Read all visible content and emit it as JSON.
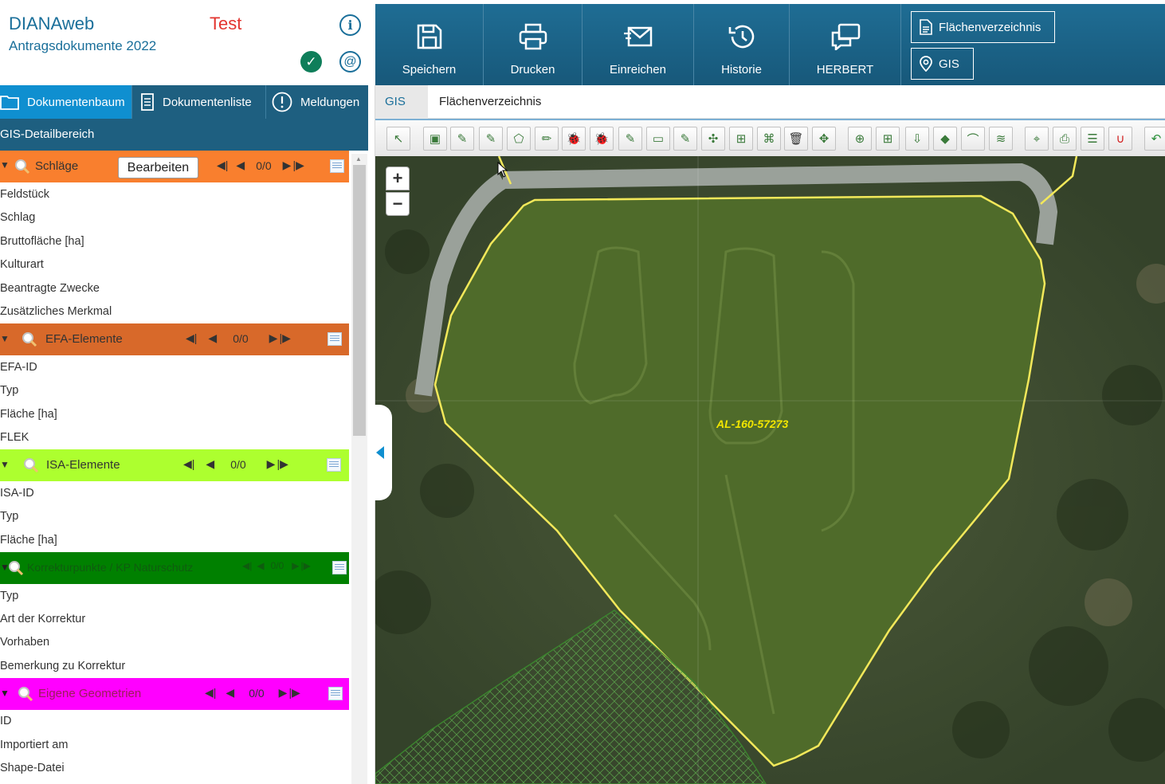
{
  "app": {
    "name": "DIANAweb",
    "subtitle": "Antragsdokumente 2022",
    "env_label": "Test"
  },
  "left_tabs": [
    {
      "label": "Dokumentenbaum",
      "active": true
    },
    {
      "label": "Dokumentenliste",
      "active": false
    },
    {
      "label": "Meldungen",
      "active": false
    }
  ],
  "detail_title": "GIS-Detailbereich",
  "groups": [
    {
      "title": "Schläge",
      "counter": "0/0",
      "color": "#f97f2e",
      "edit_label": "Bearbeiten",
      "fields": [
        "Feldstück",
        "Schlag",
        "Bruttofläche [ha]",
        "Kulturart",
        "Beantragte Zwecke",
        "Zusätzliches Merkmal"
      ]
    },
    {
      "title": "EFA-Elemente",
      "counter": "0/0",
      "color": "#d8692a",
      "fields": [
        "EFA-ID",
        "Typ",
        "Fläche [ha]",
        "FLEK"
      ]
    },
    {
      "title": "ISA-Elemente",
      "counter": "0/0",
      "color": "#adff2f",
      "fields": [
        "ISA-ID",
        "Typ",
        "Fläche [ha]"
      ]
    },
    {
      "title": "Korrekturpunkte / KP Naturschutz",
      "counter": "0/0",
      "color": "#008000",
      "fields": [
        "Typ",
        "Art der Korrektur",
        "Vorhaben",
        "Bemerkung zu Korrektur"
      ]
    },
    {
      "title": "Eigene Geometrien",
      "counter": "0/0",
      "color": "#ff00ff",
      "fields": [
        "ID",
        "Importiert am",
        "Shape-Datei"
      ]
    }
  ],
  "toolbar": {
    "buttons": [
      {
        "label": "Speichern",
        "icon": "save-icon"
      },
      {
        "label": "Drucken",
        "icon": "print-icon"
      },
      {
        "label": "Einreichen",
        "icon": "send-icon"
      },
      {
        "label": "Historie",
        "icon": "history-icon"
      },
      {
        "label": "HERBERT",
        "icon": "chat-icon"
      }
    ],
    "side_buttons": [
      {
        "label": "Flächenverzeichnis",
        "icon": "document-icon"
      },
      {
        "label": "GIS",
        "icon": "location-pin-icon"
      }
    ]
  },
  "sub_tabs": [
    {
      "label": "GIS",
      "active": true
    },
    {
      "label": "Flächenverzeichnis",
      "active": false
    }
  ],
  "map": {
    "zoom_in": "+",
    "zoom_out": "−",
    "parcel_label": "AL-160-57273",
    "outline_color": "#f2e85a"
  },
  "map_tools": [
    "select-arrow-icon",
    "add-polygon-icon",
    "edit-pencil-icon",
    "edit-pencil-blue-icon",
    "polygon-icon",
    "pencil-icon",
    "bug-icon",
    "bug-orange-icon",
    "pencil-yellow-icon",
    "note-icon",
    "pencil-green-icon",
    "split-icon",
    "merge-icon",
    "node-icon",
    "trash-icon",
    "move-icon",
    "search-layer-icon",
    "layer-add-icon",
    "layer-down-icon",
    "layer-stack-icon",
    "measure-icon",
    "layer-line-icon",
    "pin-add-icon",
    "print-icon",
    "list-icon",
    "magnet-icon",
    "undo-icon"
  ]
}
